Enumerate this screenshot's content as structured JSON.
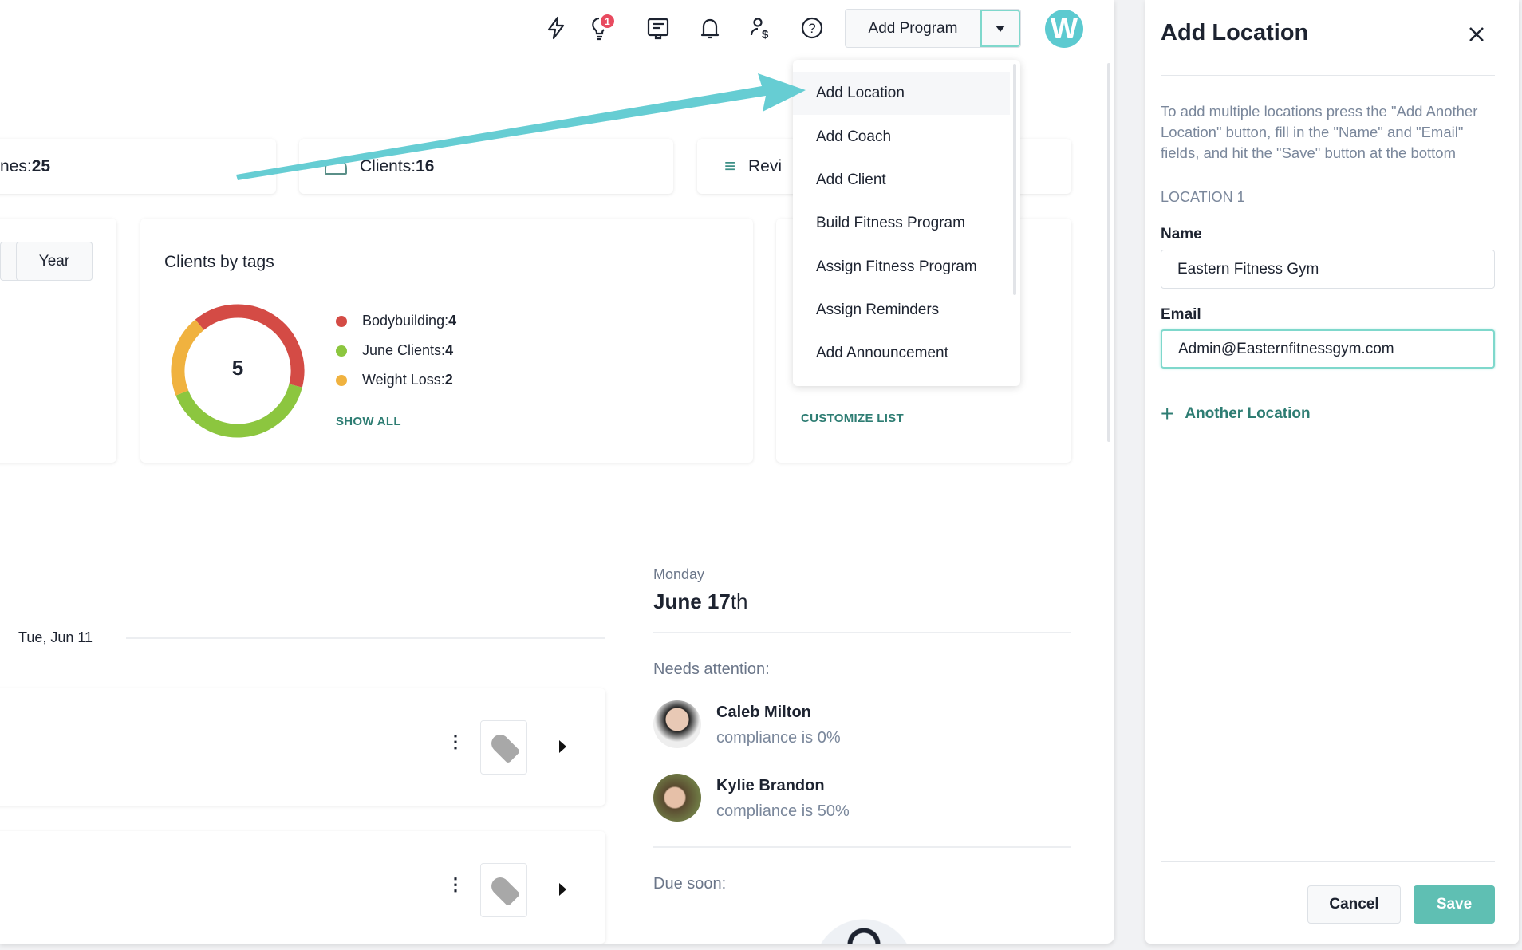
{
  "header": {
    "notification_badge": "1",
    "add_program_label": "Add Program",
    "avatar_letter": "W",
    "icons": [
      "lightning-icon",
      "lightbulb-icon",
      "message-board-icon",
      "bell-icon",
      "user-dollar-icon",
      "help-icon"
    ]
  },
  "dropdown": {
    "items": [
      "Add Location",
      "Add Coach",
      "Add Client",
      "Build Fitness Program",
      "Assign Fitness Program",
      "Assign Reminders",
      "Add Announcement"
    ],
    "active": "Add Location"
  },
  "stats": [
    {
      "label": "nes: ",
      "value": "25"
    },
    {
      "label": "Clients: ",
      "value": "16"
    },
    {
      "label": "Revi",
      "value": ""
    }
  ],
  "period": {
    "year_label": "Year"
  },
  "tags_card": {
    "title": "Clients by tags",
    "total": "5",
    "show_all": "SHOW ALL",
    "chart_data": {
      "type": "pie",
      "categories": [
        "Bodybuilding",
        "June Clients",
        "Weight Loss"
      ],
      "values": [
        4,
        4,
        2
      ],
      "colors": [
        "#d44b45",
        "#8cc63f",
        "#f0b23f"
      ]
    }
  },
  "tags_legend": [
    {
      "label": "Bodybuilding: ",
      "value": "4"
    },
    {
      "label": "June Clients: ",
      "value": "4"
    },
    {
      "label": "Weight Loss: ",
      "value": "2"
    }
  ],
  "third_card": {
    "customize": "CUSTOMIZE LIST"
  },
  "timeline": {
    "date": "Tue, Jun 11"
  },
  "day": {
    "weekday": "Monday",
    "date_bold": "June 17",
    "date_suffix": "th",
    "needs_attention": "Needs attention:",
    "due_soon": "Due soon:",
    "clients": [
      {
        "name": "Caleb Milton",
        "status": "compliance is 0%"
      },
      {
        "name": "Kylie Brandon",
        "status": "compliance is 50%"
      }
    ]
  },
  "panel": {
    "title": "Add Location",
    "description": "To add multiple locations press the \"Add Another Location\" button, fill in the \"Name\" and \"Email\" fields, and hit the \"Save\" button at the bottom",
    "section": "LOCATION 1",
    "name_label": "Name",
    "name_value": "Eastern Fitness Gym",
    "email_label": "Email",
    "email_value": "Admin@Easternfitnessgym.com",
    "add_another": "Another Location",
    "cancel": "Cancel",
    "save": "Save"
  },
  "colors": {
    "accent": "#62c9cf",
    "save": "#5fbfb3",
    "link": "#2e7d73"
  }
}
